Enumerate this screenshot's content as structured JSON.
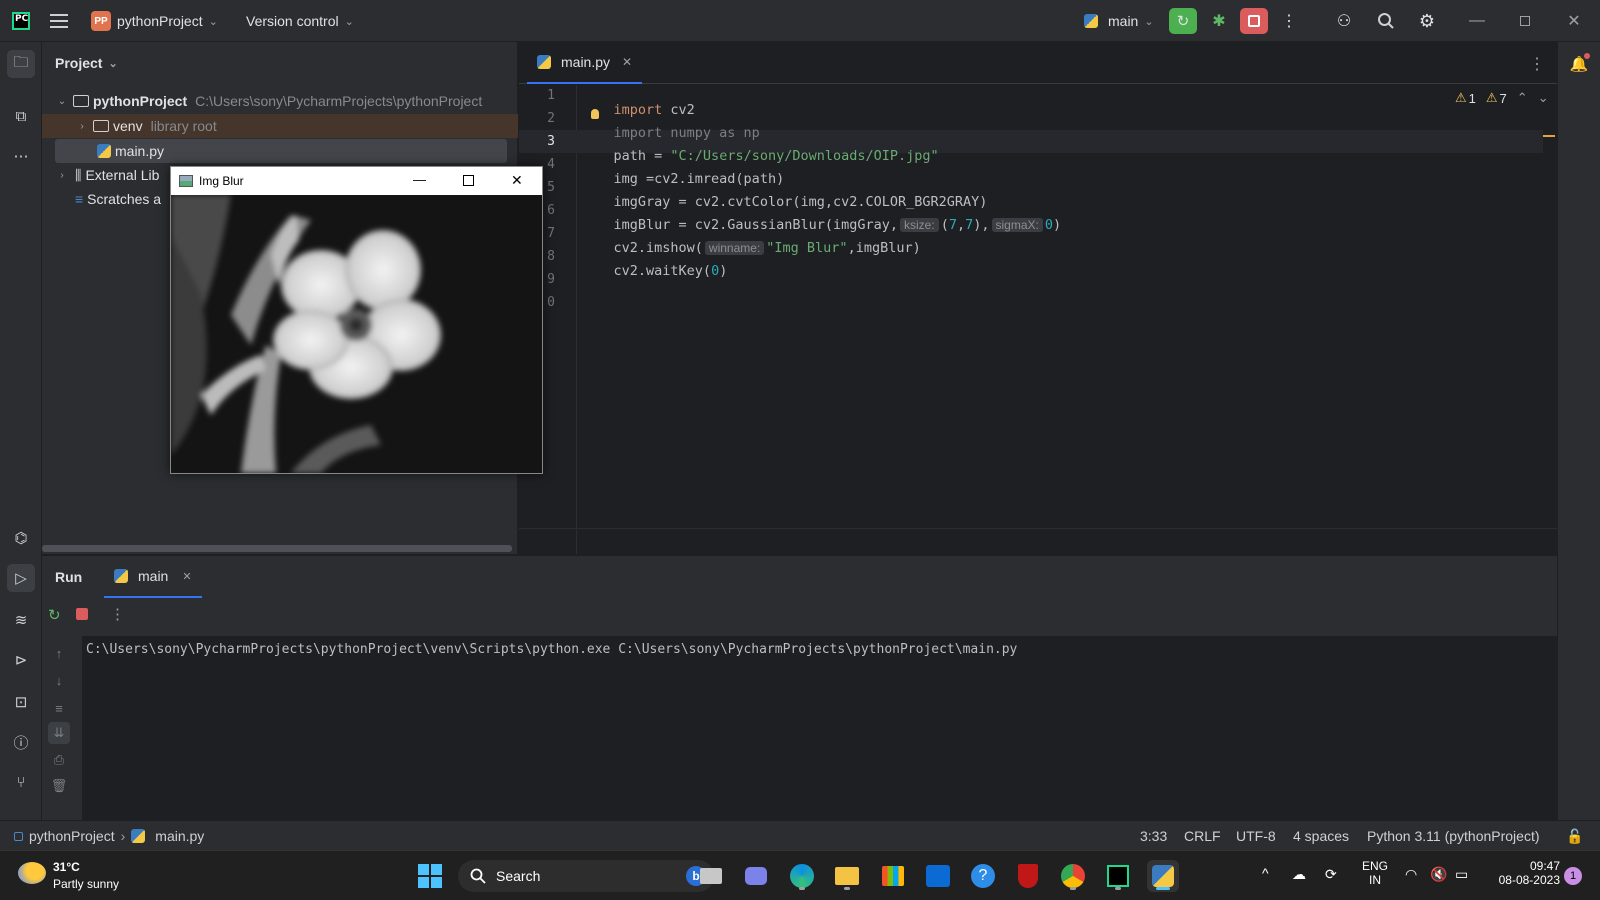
{
  "titlebar": {
    "app_logo": "PC",
    "project_badge": "PP",
    "project_name": "pythonProject",
    "vcs_label": "Version control",
    "run_config": "main"
  },
  "project_panel": {
    "title": "Project",
    "tree": [
      {
        "label": "pythonProject",
        "detail": "C:\\Users\\sony\\PycharmProjects\\pythonProject",
        "icon": "folder-icon"
      },
      {
        "label": "venv",
        "detail": "library root",
        "icon": "folder-icon"
      },
      {
        "label": "main.py",
        "detail": "",
        "icon": "python-file-icon"
      },
      {
        "label": "External Lib",
        "detail": "",
        "icon": "library-icon"
      },
      {
        "label": "Scratches a",
        "detail": "",
        "icon": "scratches-icon"
      }
    ]
  },
  "editor": {
    "tab_label": "main.py",
    "line_numbers": [
      "1",
      "2",
      "3",
      "4",
      "5",
      "6",
      "7",
      "8",
      "9",
      "0"
    ],
    "inspection": {
      "errors": "1",
      "warnings": "7"
    },
    "code": {
      "l1_kw": "import",
      "l1_rest": " cv2",
      "l2": "import numpy as np",
      "l3_a": "path = ",
      "l3_str": "\"C:/Users/sony/Downloads/OIP.jpg\"",
      "l4": "img =cv2.imread(path)",
      "l5": "imgGray = cv2.cvtColor(img,cv2.COLOR_BGR2GRAY)",
      "l6_a": "imgBlur = cv2.GaussianBlur(imgGray,",
      "l6_hint1": "ksize:",
      "l6_b": "(",
      "l6_n1": "7",
      "l6_c": ",",
      "l6_n2": "7",
      "l6_d": "),",
      "l6_hint2": "sigmaX:",
      "l6_n3": "0",
      "l6_e": ")",
      "l7_a": "cv2.imshow(",
      "l7_hint": "winname:",
      "l7_str": "\"Img Blur\"",
      "l7_b": ",imgBlur)",
      "l8_a": "cv2.waitKey(",
      "l8_n": "0",
      "l8_b": ")"
    }
  },
  "blur_window": {
    "title": "Img Blur"
  },
  "run_panel": {
    "tab_run": "Run",
    "tab_main": "main",
    "console_output": "C:\\Users\\sony\\PycharmProjects\\pythonProject\\venv\\Scripts\\python.exe C:\\Users\\sony\\PycharmProjects\\pythonProject\\main.py"
  },
  "statusbar": {
    "breadcrumb_project": "pythonProject",
    "breadcrumb_file": "main.py",
    "position": "3:33",
    "line_sep": "CRLF",
    "encoding": "UTF-8",
    "indent": "4 spaces",
    "interpreter": "Python 3.11 (pythonProject)"
  },
  "taskbar": {
    "weather_temp": "31°C",
    "weather_desc": "Partly sunny",
    "search_label": "Search",
    "lang_top": "ENG",
    "lang_bottom": "IN",
    "time": "09:47",
    "date": "08-08-2023",
    "notification_count": "1"
  },
  "colors": {
    "accent": "#3574f0",
    "run_green": "#4caf50",
    "stop_red": "#db5c5c"
  }
}
